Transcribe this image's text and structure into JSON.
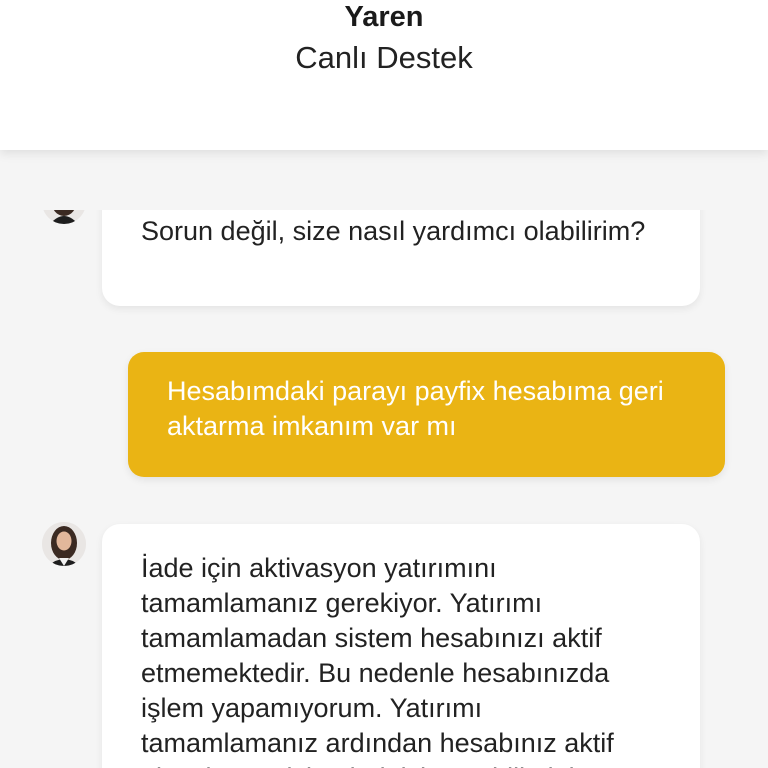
{
  "header": {
    "agent_name": "Yaren",
    "status": "Canlı Destek"
  },
  "messages": [
    {
      "sender": "agent",
      "text": "Sorun değil, size nasıl yardımcı olabilirim?"
    },
    {
      "sender": "user",
      "text": "Hesabımdaki parayı payfix hesabıma geri aktarma imkanım var mı"
    },
    {
      "sender": "agent",
      "text": "İade için aktivasyon yatırımını tamamlamanız gerekiyor. Yatırımı tamamlamadan sistem hesabınızı aktif etmemektedir. Bu nedenle hesabınızda işlem yapamıyorum. Yatırımı tamamlamanız ardından hesabınız aktif olacaktır ve işlemlerinizi yapabilirsiniz."
    }
  ],
  "colors": {
    "user_bubble": "#eab414",
    "agent_bubble": "#ffffff",
    "background": "#f5f5f5"
  }
}
